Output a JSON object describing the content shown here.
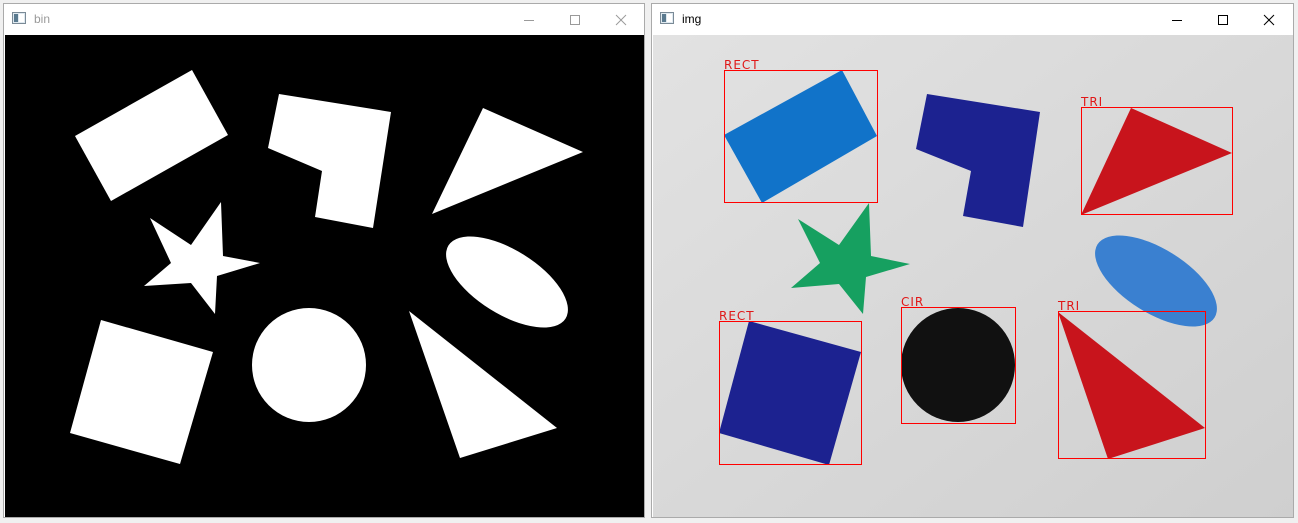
{
  "windows": {
    "bin": {
      "title": "bin"
    },
    "img": {
      "title": "img"
    }
  },
  "controls": {
    "minimize_icon": "minimize-icon",
    "maximize_icon": "maximize-icon",
    "close_icon": "close-icon"
  },
  "detections": [
    {
      "label": "RECT",
      "color": "#ff0000"
    },
    {
      "label": "TRI",
      "color": "#ff0000"
    },
    {
      "label": "CIR",
      "color": "#ff0000"
    },
    {
      "label": "RECT",
      "color": "#ff0000"
    },
    {
      "label": "TRI",
      "color": "#ff0000"
    }
  ],
  "colors": {
    "light_blue": "#1173c9",
    "navy": "#1c2290",
    "red": "#c8141c",
    "green": "#16a060",
    "black": "#111111",
    "oval_blue": "#3a80d0",
    "binary_fg": "#ffffff",
    "binary_bg": "#000000",
    "box": "#ff0000"
  }
}
